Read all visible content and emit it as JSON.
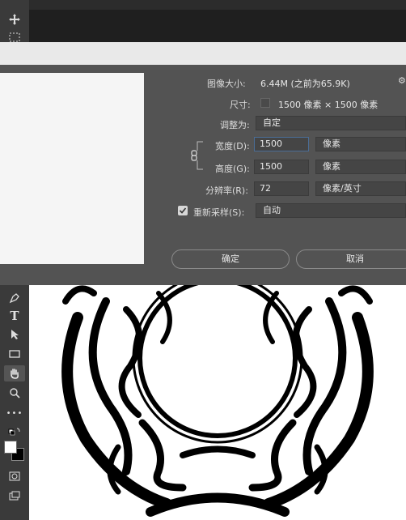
{
  "window": {
    "title_fragment": ""
  },
  "toolbar": {
    "tools": [
      {
        "name": "move-tool",
        "glyph": "✥"
      },
      {
        "name": "marquee-tool",
        "glyph": "⬚"
      },
      {
        "name": "pen-tool",
        "glyph": "✒"
      },
      {
        "name": "type-tool",
        "glyph": "T"
      },
      {
        "name": "path-selection-tool",
        "glyph": "➤"
      },
      {
        "name": "rectangle-tool",
        "glyph": "▭"
      },
      {
        "name": "hand-tool",
        "glyph": "✋"
      },
      {
        "name": "zoom-tool",
        "glyph": "⌕"
      },
      {
        "name": "more-tools",
        "glyph": "•••"
      }
    ]
  },
  "dialog": {
    "image_size_label": "图像大小:",
    "image_size_value": "6.44M (之前为65.9K)",
    "dimensions_label": "尺寸:",
    "dimensions_value": "1500 像素 × 1500 像素",
    "fit_to_label": "调整为:",
    "fit_to_value": "自定",
    "width_label": "宽度(D):",
    "width_value": "1500",
    "width_unit": "像素",
    "height_label": "高度(G):",
    "height_value": "1500",
    "height_unit": "像素",
    "resolution_label": "分辨率(R):",
    "resolution_value": "72",
    "resolution_unit": "像素/英寸",
    "resample_label": "重新采样(S):",
    "resample_checked": true,
    "resample_value": "自动",
    "ok_label": "确定",
    "cancel_label": "取消"
  },
  "colors": {
    "dialog_bg": "#535353",
    "toolbar_bg": "#3a3a3a",
    "active_field_border": "#4a6d96"
  }
}
